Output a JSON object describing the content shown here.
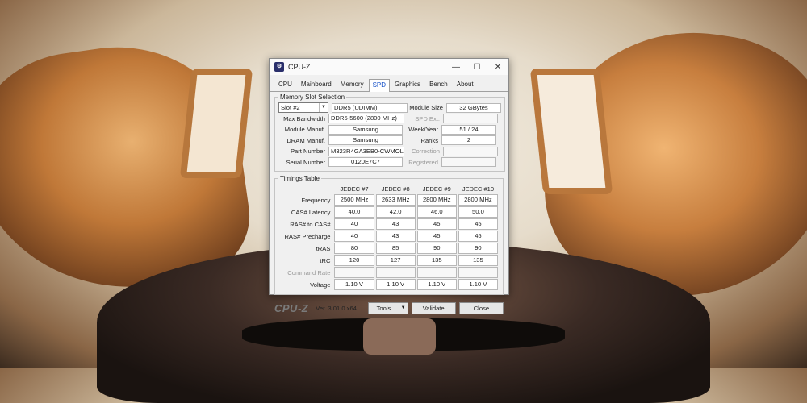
{
  "window": {
    "title": "CPU-Z",
    "icon": "cpuz-app-icon",
    "minimize": "—",
    "maximize": "☐",
    "close": "✕"
  },
  "tabs": [
    "CPU",
    "Mainboard",
    "Memory",
    "SPD",
    "Graphics",
    "Bench",
    "About"
  ],
  "active_tab": "SPD",
  "slot_section": {
    "legend": "Memory Slot Selection",
    "slot_select": "Slot #2",
    "memory_type": "DDR5 (UDIMM)",
    "module_size_label": "Module Size",
    "module_size": "32 GBytes",
    "max_bandwidth_label": "Max Bandwidth",
    "max_bandwidth": "DDR5-5600 (2800 MHz)",
    "spd_ext_label": "SPD Ext.",
    "spd_ext": "",
    "module_manuf_label": "Module Manuf.",
    "module_manuf": "Samsung",
    "week_year_label": "Week/Year",
    "week_year": "51 / 24",
    "dram_manuf_label": "DRAM Manuf.",
    "dram_manuf": "Samsung",
    "ranks_label": "Ranks",
    "ranks": "2",
    "part_number_label": "Part Number",
    "part_number": "M323R4GA3EB0-CWMOL",
    "correction_label": "Correction",
    "correction": "",
    "serial_number_label": "Serial Number",
    "serial_number": "0120E7C7",
    "registered_label": "Registered",
    "registered": ""
  },
  "timings": {
    "legend": "Timings Table",
    "columns": [
      "JEDEC #7",
      "JEDEC #8",
      "JEDEC #9",
      "JEDEC #10"
    ],
    "rows": [
      {
        "label": "Frequency",
        "values": [
          "2500 MHz",
          "2633 MHz",
          "2800 MHz",
          "2800 MHz"
        ]
      },
      {
        "label": "CAS# Latency",
        "values": [
          "40.0",
          "42.0",
          "46.0",
          "50.0"
        ]
      },
      {
        "label": "RAS# to CAS#",
        "values": [
          "40",
          "43",
          "45",
          "45"
        ]
      },
      {
        "label": "RAS# Precharge",
        "values": [
          "40",
          "43",
          "45",
          "45"
        ]
      },
      {
        "label": "tRAS",
        "values": [
          "80",
          "85",
          "90",
          "90"
        ]
      },
      {
        "label": "tRC",
        "values": [
          "120",
          "127",
          "135",
          "135"
        ]
      },
      {
        "label": "Command Rate",
        "values": [
          "",
          "",
          "",
          ""
        ],
        "dim": true
      },
      {
        "label": "Voltage",
        "values": [
          "1.10 V",
          "1.10 V",
          "1.10 V",
          "1.10 V"
        ]
      }
    ]
  },
  "footer": {
    "logo": "CPU-Z",
    "version": "Ver. 3.01.0.x64",
    "tools": "Tools",
    "validate": "Validate",
    "close": "Close"
  }
}
